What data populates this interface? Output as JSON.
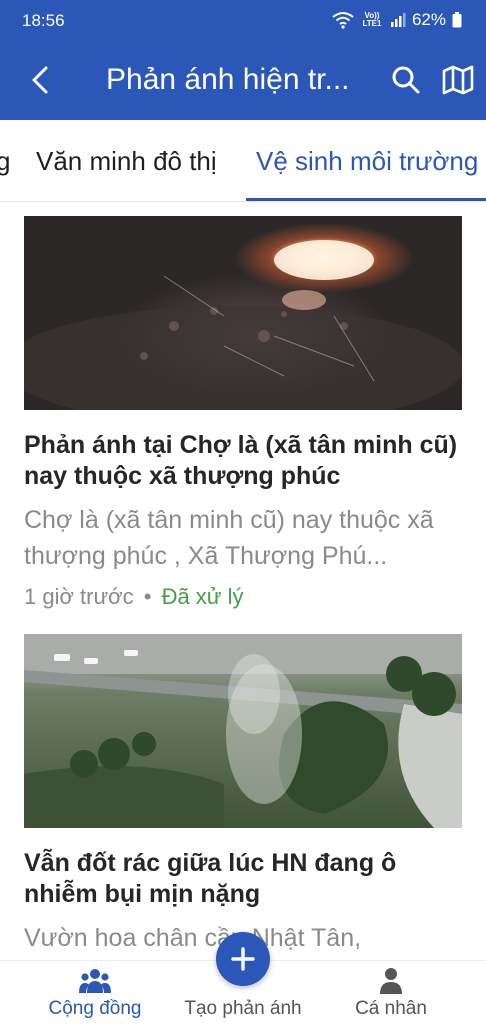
{
  "status_bar": {
    "time": "18:56",
    "network_label": "Vo)) LTE1",
    "battery_percent": "62%"
  },
  "app_bar": {
    "title": "Phản ánh hiện tr...",
    "back_icon": "back-arrow-icon",
    "search_icon": "search-icon",
    "map_icon": "map-icon"
  },
  "tabs": [
    {
      "label": "g",
      "active": false
    },
    {
      "label": "Văn minh đô thị",
      "active": false
    },
    {
      "label": "Vệ sinh môi trường",
      "active": true
    }
  ],
  "posts": [
    {
      "title": "Phản ánh tại Chợ là (xã tân minh cũ) nay thuộc xã thượng phúc",
      "snippet": "Chợ là (xã tân minh cũ) nay thuộc xã thượng phúc , Xã Thượng Phú...",
      "time": "1 giờ trước",
      "separator": "•",
      "status": "Đã xử lý"
    },
    {
      "title": "Vẫn đốt rác giữa lúc HN đang ô nhiễm bụi mịn nặng",
      "snippet": "Vườn hoa chân cầu Nhật Tân,"
    }
  ],
  "bottom_nav": {
    "items": [
      {
        "label": "Cộng đồng",
        "icon": "community-icon",
        "active": true
      },
      {
        "label": "Tạo phản ánh",
        "icon": "plus-icon",
        "active": false
      },
      {
        "label": "Cá nhân",
        "icon": "person-icon",
        "active": false
      }
    ]
  },
  "colors": {
    "primary": "#2a57b8",
    "status_done": "#43a047",
    "muted_text": "#8a8a8a"
  }
}
